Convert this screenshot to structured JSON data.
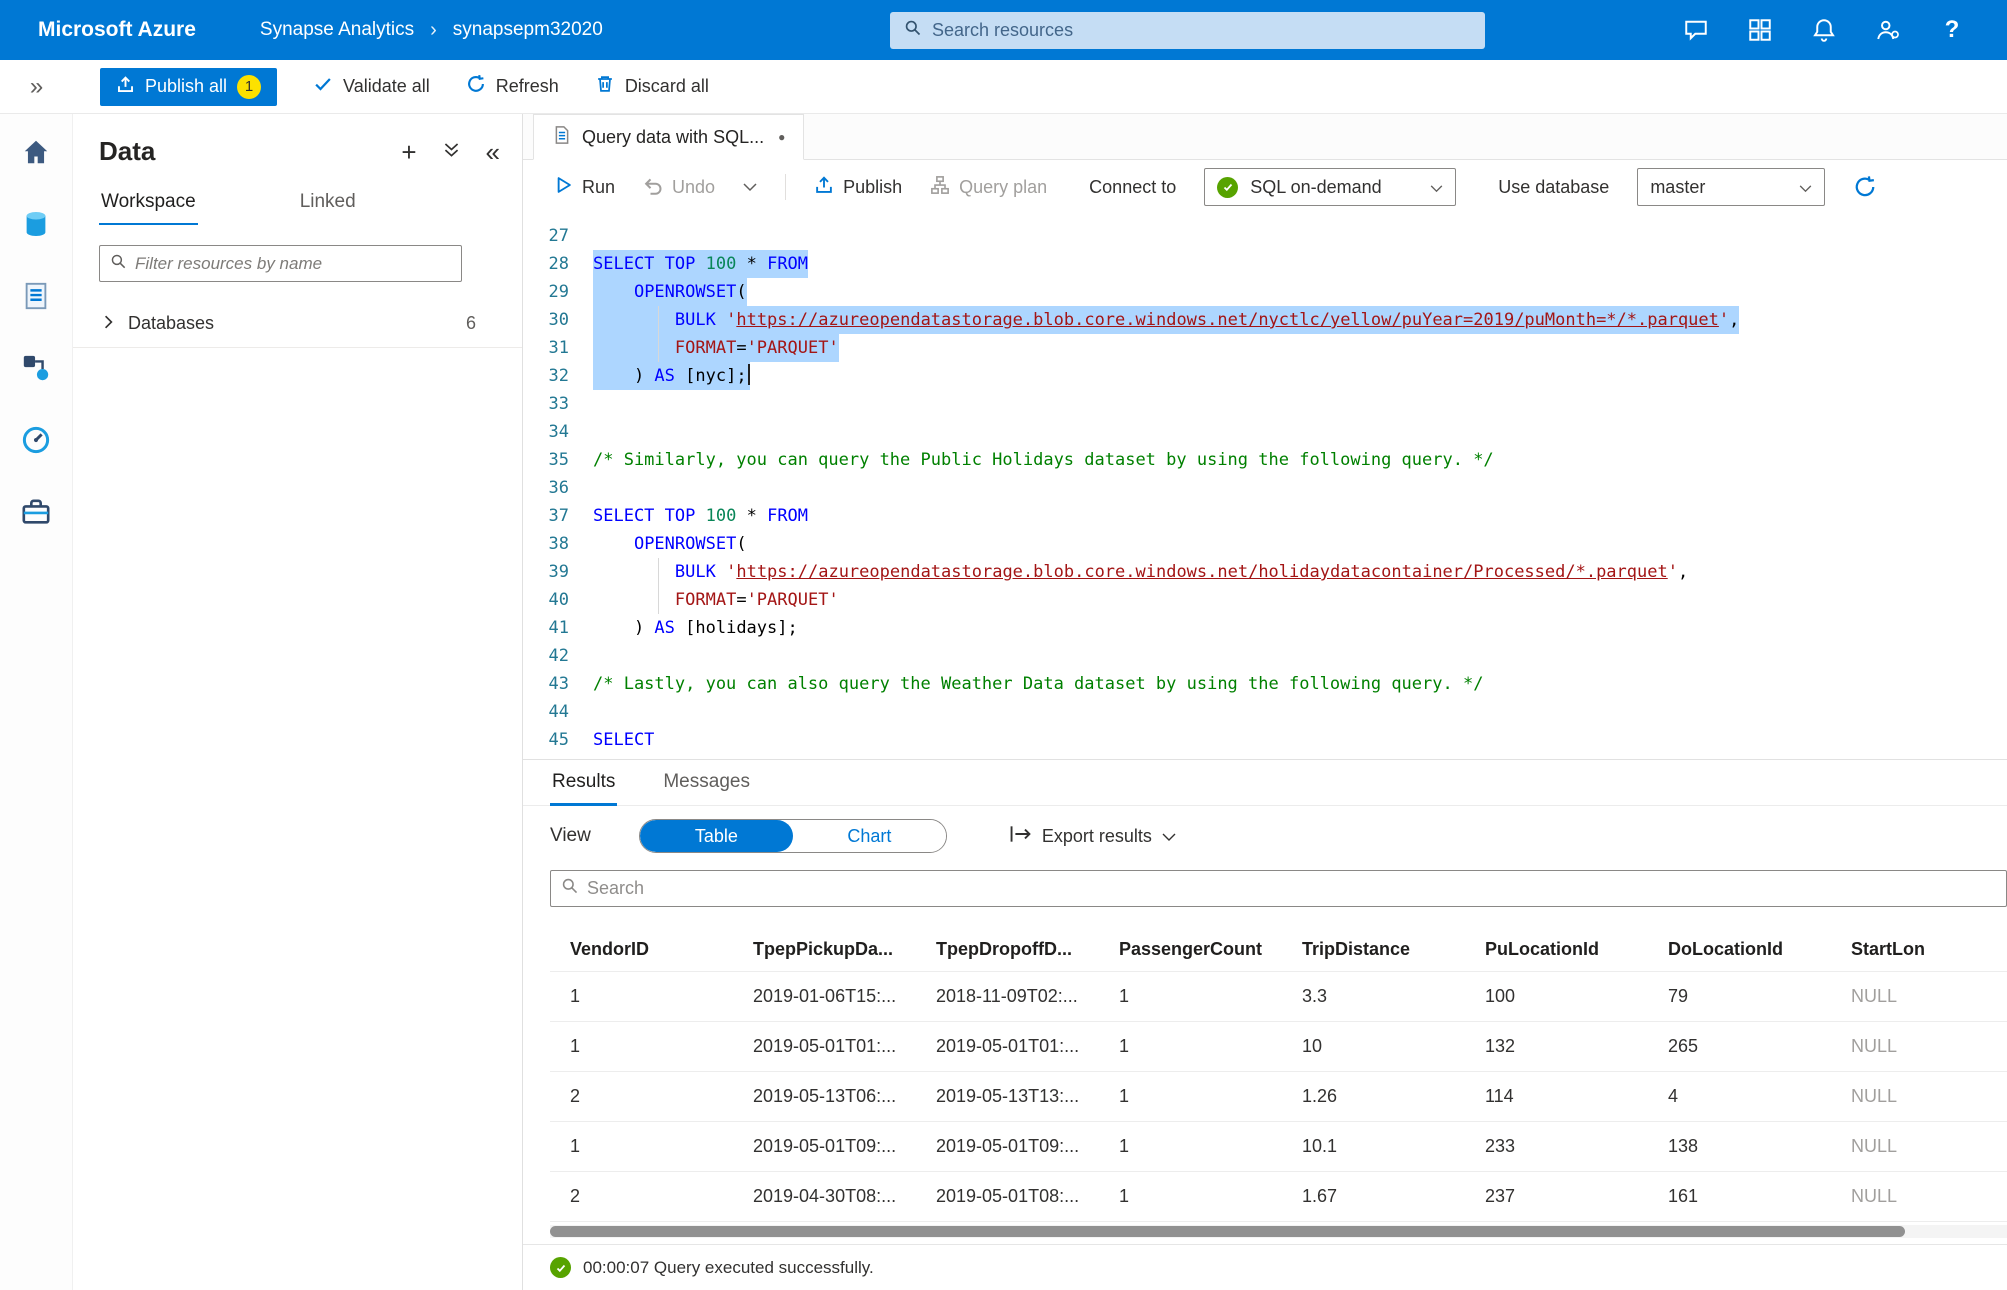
{
  "colors": {
    "accent": "#0078d4",
    "selection": "#add6ff",
    "success": "#57a300",
    "badge": "#fce100",
    "keyword": "#0000ff",
    "string": "#a31515",
    "comment": "#008000"
  },
  "icons": {
    "expand": "»",
    "collapse": "«",
    "plus": "+",
    "help": "?",
    "breadcrumb_chevron": "›",
    "dirty_dot": "●"
  },
  "topbar": {
    "brand": "Microsoft Azure",
    "breadcrumb_1": "Synapse Analytics",
    "breadcrumb_2": "synapsepm32020",
    "search_placeholder": "Search resources"
  },
  "cmdbar": {
    "publish_all": "Publish all",
    "publish_badge": "1",
    "validate_all": "Validate all",
    "refresh": "Refresh",
    "discard_all": "Discard all"
  },
  "data_panel": {
    "title": "Data",
    "tabs": [
      "Workspace",
      "Linked"
    ],
    "filter_placeholder": "Filter resources by name",
    "tree_label": "Databases",
    "tree_count": "6"
  },
  "editor": {
    "tab_title": "Query data with SQL...",
    "toolbar": {
      "run": "Run",
      "undo": "Undo",
      "publish": "Publish",
      "query_plan": "Query plan",
      "connect_to": "Connect to",
      "connect_value": "SQL on-demand",
      "use_database": "Use database",
      "database_value": "master"
    },
    "lines": [
      {
        "n": "27",
        "tokens": []
      },
      {
        "n": "28",
        "sel": true,
        "tokens": [
          {
            "t": "k",
            "v": "SELECT"
          },
          {
            "t": "p",
            "v": " "
          },
          {
            "t": "k",
            "v": "TOP"
          },
          {
            "t": "p",
            "v": " "
          },
          {
            "t": "n",
            "v": "100"
          },
          {
            "t": "p",
            "v": " * "
          },
          {
            "t": "k",
            "v": "FROM"
          }
        ]
      },
      {
        "n": "29",
        "sel": true,
        "tokens": [
          {
            "t": "p",
            "v": "    "
          },
          {
            "t": "k",
            "v": "OPENROWSET"
          },
          {
            "t": "p",
            "v": "("
          }
        ]
      },
      {
        "n": "30",
        "sel": true,
        "g": true,
        "tokens": [
          {
            "t": "p",
            "v": "        "
          },
          {
            "t": "k",
            "v": "BULK"
          },
          {
            "t": "p",
            "v": " "
          },
          {
            "t": "s",
            "v": "'"
          },
          {
            "t": "u",
            "v": "https://azureopendatastorage.blob.core.windows.net/nyctlc/yellow/puYear=2019/puMonth=*/*.parquet"
          },
          {
            "t": "s",
            "v": "'"
          },
          {
            "t": "p",
            "v": ","
          }
        ]
      },
      {
        "n": "31",
        "sel": true,
        "g": true,
        "tokens": [
          {
            "t": "p",
            "v": "        "
          },
          {
            "t": "s",
            "v": "FORMAT"
          },
          {
            "t": "p",
            "v": "="
          },
          {
            "t": "s",
            "v": "'PARQUET'"
          }
        ]
      },
      {
        "n": "32",
        "sel": true,
        "cursor": true,
        "tokens": [
          {
            "t": "p",
            "v": "    ) "
          },
          {
            "t": "k",
            "v": "AS"
          },
          {
            "t": "p",
            "v": " [nyc];"
          }
        ]
      },
      {
        "n": "33",
        "tokens": []
      },
      {
        "n": "34",
        "tokens": []
      },
      {
        "n": "35",
        "tokens": [
          {
            "t": "c",
            "v": "/* Similarly, you can query the Public Holidays dataset by using the following query. */"
          }
        ]
      },
      {
        "n": "36",
        "tokens": []
      },
      {
        "n": "37",
        "tokens": [
          {
            "t": "k",
            "v": "SELECT"
          },
          {
            "t": "p",
            "v": " "
          },
          {
            "t": "k",
            "v": "TOP"
          },
          {
            "t": "p",
            "v": " "
          },
          {
            "t": "n",
            "v": "100"
          },
          {
            "t": "p",
            "v": " * "
          },
          {
            "t": "k",
            "v": "FROM"
          }
        ]
      },
      {
        "n": "38",
        "tokens": [
          {
            "t": "p",
            "v": "    "
          },
          {
            "t": "k",
            "v": "OPENROWSET"
          },
          {
            "t": "p",
            "v": "("
          }
        ]
      },
      {
        "n": "39",
        "g": true,
        "tokens": [
          {
            "t": "p",
            "v": "        "
          },
          {
            "t": "k",
            "v": "BULK"
          },
          {
            "t": "p",
            "v": " "
          },
          {
            "t": "s",
            "v": "'"
          },
          {
            "t": "u",
            "v": "https://azureopendatastorage.blob.core.windows.net/holidaydatacontainer/Processed/*.parquet"
          },
          {
            "t": "s",
            "v": "'"
          },
          {
            "t": "p",
            "v": ","
          }
        ]
      },
      {
        "n": "40",
        "g": true,
        "tokens": [
          {
            "t": "p",
            "v": "        "
          },
          {
            "t": "s",
            "v": "FORMAT"
          },
          {
            "t": "p",
            "v": "="
          },
          {
            "t": "s",
            "v": "'PARQUET'"
          }
        ]
      },
      {
        "n": "41",
        "tokens": [
          {
            "t": "p",
            "v": "    ) "
          },
          {
            "t": "k",
            "v": "AS"
          },
          {
            "t": "p",
            "v": " [holidays];"
          }
        ]
      },
      {
        "n": "42",
        "tokens": []
      },
      {
        "n": "43",
        "tokens": [
          {
            "t": "c",
            "v": "/* Lastly, you can also query the Weather Data dataset by using the following query. */"
          }
        ]
      },
      {
        "n": "44",
        "tokens": []
      },
      {
        "n": "45",
        "tokens": [
          {
            "t": "k",
            "v": "SELECT"
          }
        ]
      }
    ]
  },
  "results": {
    "tabs": [
      "Results",
      "Messages"
    ],
    "view_label": "View",
    "view_options": [
      "Table",
      "Chart"
    ],
    "export_label": "Export results",
    "search_placeholder": "Search",
    "columns": [
      "VendorID",
      "TpepPickupDa...",
      "TpepDropoffD...",
      "PassengerCount",
      "TripDistance",
      "PuLocationId",
      "DoLocationId",
      "StartLon"
    ],
    "rows": [
      [
        "1",
        "2019-01-06T15:...",
        "2018-11-09T02:...",
        "1",
        "3.3",
        "100",
        "79",
        "NULL"
      ],
      [
        "1",
        "2019-05-01T01:...",
        "2019-05-01T01:...",
        "1",
        "10",
        "132",
        "265",
        "NULL"
      ],
      [
        "2",
        "2019-05-13T06:...",
        "2019-05-13T13:...",
        "1",
        "1.26",
        "114",
        "4",
        "NULL"
      ],
      [
        "1",
        "2019-05-01T09:...",
        "2019-05-01T09:...",
        "1",
        "10.1",
        "233",
        "138",
        "NULL"
      ],
      [
        "2",
        "2019-04-30T08:...",
        "2019-05-01T08:...",
        "1",
        "1.67",
        "237",
        "161",
        "NULL"
      ]
    ],
    "status": "00:00:07 Query executed successfully."
  }
}
